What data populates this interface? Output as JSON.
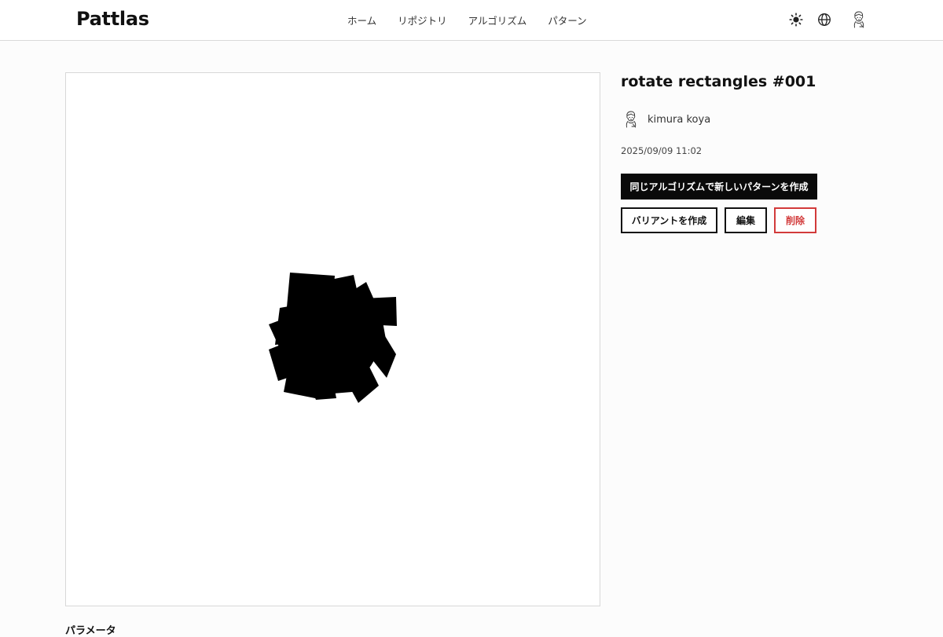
{
  "header": {
    "logo": "Pattlas",
    "nav": [
      "ホーム",
      "リポジトリ",
      "アルゴリズム",
      "パターン"
    ],
    "icons": [
      "sun-icon",
      "globe-icon",
      "user-avatar"
    ]
  },
  "pattern": {
    "title": "rotate rectangles #001",
    "author": "kimura koya",
    "date": "2025/09/09 11:02"
  },
  "actions": {
    "create_with_same_algorithm": "同じアルゴリズムで新しいパターンを作成",
    "create_variant": "バリアントを作成",
    "edit": "編集",
    "delete": "削除"
  },
  "params": {
    "label": "パラメータ"
  },
  "colors": {
    "primary": "#0a0a0a",
    "danger": "#d23a3a",
    "background": "#fcfcfc"
  }
}
